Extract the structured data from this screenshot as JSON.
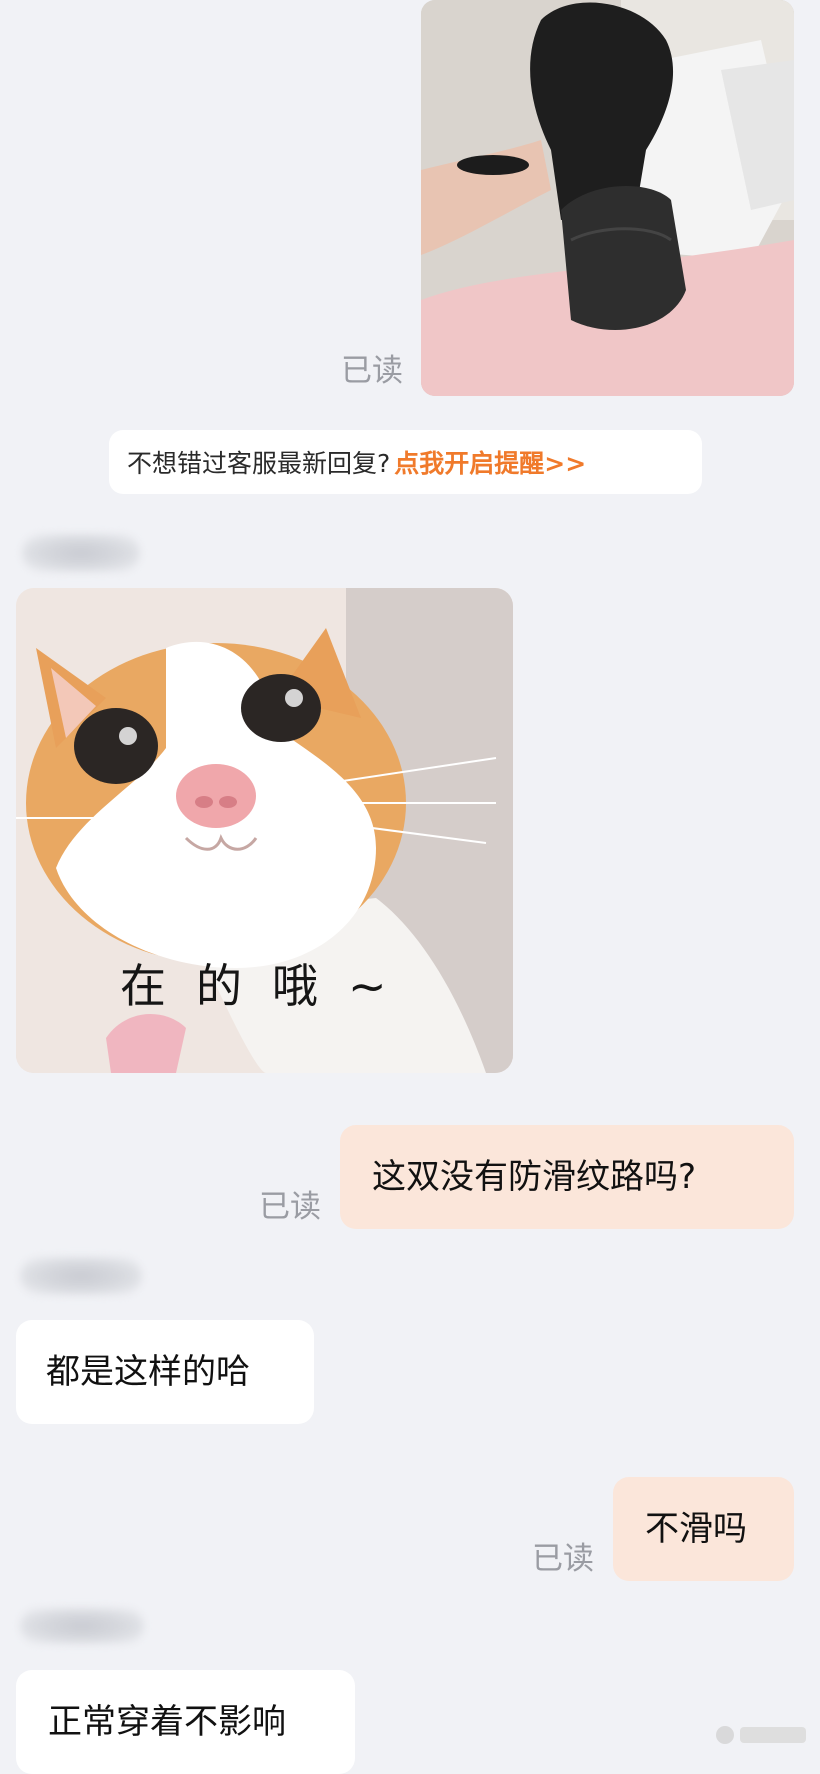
{
  "read_label": "已读",
  "system_notice": {
    "text": "不想错过客服最新回复?",
    "link": "点我开启提醒>>"
  },
  "sticker": {
    "caption": "在的哦~"
  },
  "messages": {
    "msg1": "这双没有防滑纹路吗?",
    "msg2": "都是这样的哈",
    "msg3": "不滑吗",
    "msg4": "正常穿着不影响"
  },
  "colors": {
    "background": "#f1f2f6",
    "outgoing_bubble": "#fbe6da",
    "incoming_bubble": "#ffffff",
    "read_text": "#9a9ca3",
    "notice_link": "#f07a2b"
  }
}
